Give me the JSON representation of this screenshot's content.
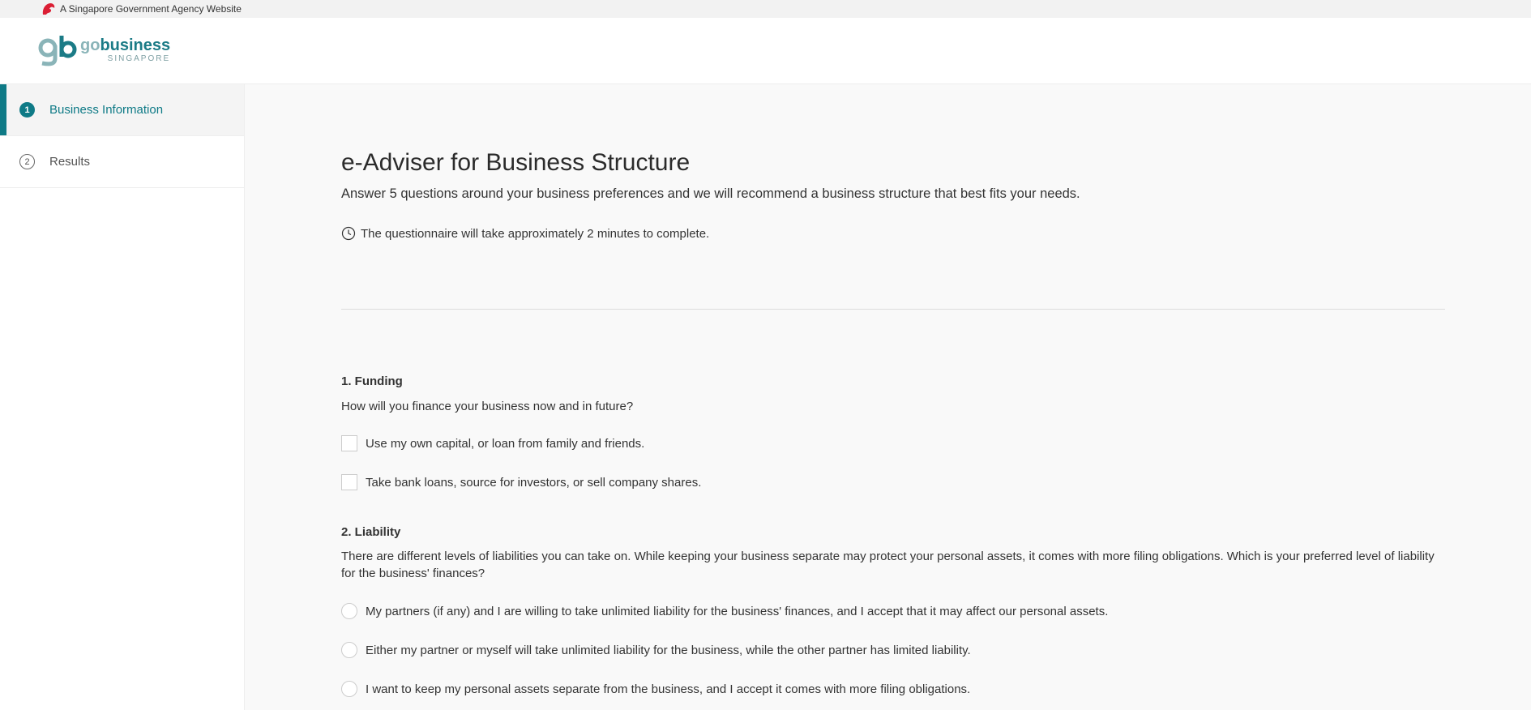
{
  "masthead": {
    "text": "A Singapore Government Agency Website",
    "icon": "lion-head-icon"
  },
  "brand": {
    "go": "go",
    "business": "business",
    "sub": "SINGAPORE",
    "accent": "#0e7a86"
  },
  "steps": [
    {
      "number": "1",
      "label": "Business Information",
      "active": true
    },
    {
      "number": "2",
      "label": "Results",
      "active": false
    }
  ],
  "page": {
    "title": "e-Adviser for Business Structure",
    "intro": "Answer 5 questions around your business preferences and we will recommend a business structure that best fits your needs.",
    "duration": "The questionnaire will take approximately 2 minutes to complete."
  },
  "questions": [
    {
      "title": "1. Funding",
      "text": "How will you finance your business now and in future?",
      "type": "checkbox",
      "options": [
        "Use my own capital, or loan from family and friends.",
        "Take bank loans, source for investors, or sell company shares."
      ]
    },
    {
      "title": "2. Liability",
      "text": "There are different levels of liabilities you can take on. While keeping your business separate may protect your personal assets, it comes with more filing obligations. Which is your preferred level of liability for the business' finances?",
      "type": "radio",
      "options": [
        "My partners (if any) and I are willing to take unlimited liability for the business' finances, and I accept that it may affect our personal assets.",
        "Either my partner or myself will take unlimited liability for the business, while the other partner has limited liability.",
        "I want to keep my personal assets separate from the business, and I accept it comes with more filing obligations."
      ]
    }
  ]
}
